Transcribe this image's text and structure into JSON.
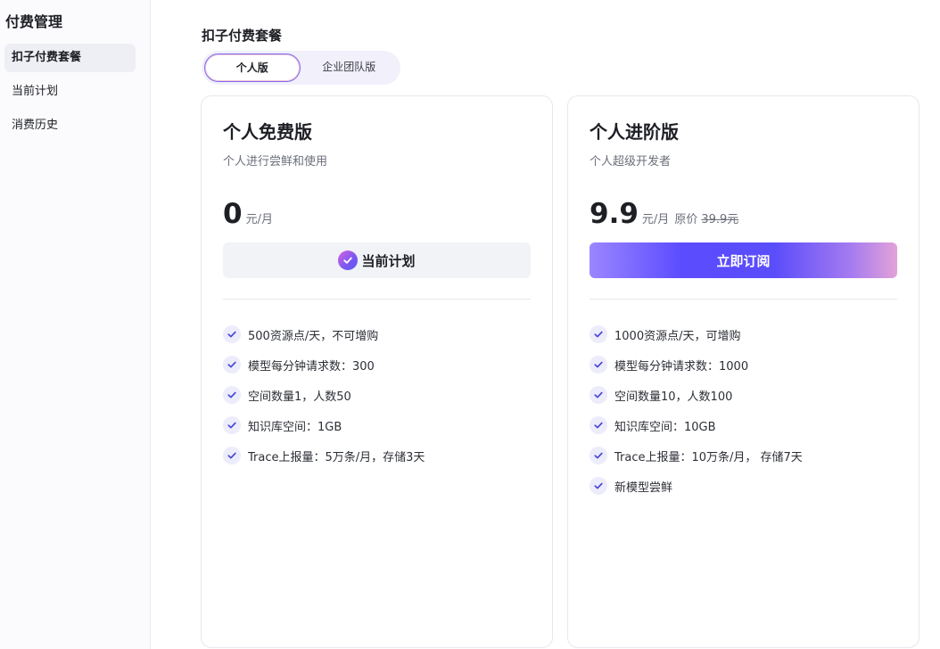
{
  "sidebar": {
    "title": "付费管理",
    "items": [
      {
        "label": "扣子付费套餐",
        "active": true
      },
      {
        "label": "当前计划",
        "active": false
      },
      {
        "label": "消费历史",
        "active": false
      }
    ]
  },
  "main": {
    "title": "扣子付费套餐",
    "tabs": [
      {
        "label": "个人版",
        "active": true
      },
      {
        "label": "企业团队版",
        "active": false
      }
    ]
  },
  "plans": {
    "free": {
      "name": "个人免费版",
      "desc": "个人进行尝鲜和使用",
      "price": "0",
      "unit": "元/月",
      "cta_label": "当前计划",
      "features": [
        "500资源点/天，不可增购",
        "模型每分钟请求数：300",
        "空间数量1，人数50",
        "知识库空间：1GB",
        "Trace上报量：5万条/月，存储3天"
      ]
    },
    "pro": {
      "name": "个人进阶版",
      "desc": "个人超级开发者",
      "price": "9.9",
      "unit": "元/月",
      "orig_label": "原价",
      "orig_price": "39.9元",
      "cta_label": "立即订阅",
      "features": [
        "1000资源点/天，可增购",
        "模型每分钟请求数：1000",
        "空间数量10，人数100",
        "知识库空间：10GB",
        "Trace上报量：10万条/月， 存储7天",
        "新模型尝鲜"
      ]
    }
  },
  "colors": {
    "accent": "#5b4cff",
    "check_bg": "#ececfb",
    "check_stroke": "#4a47d8"
  },
  "icons": {
    "feature": "check-icon",
    "current": "check-circle-icon"
  }
}
